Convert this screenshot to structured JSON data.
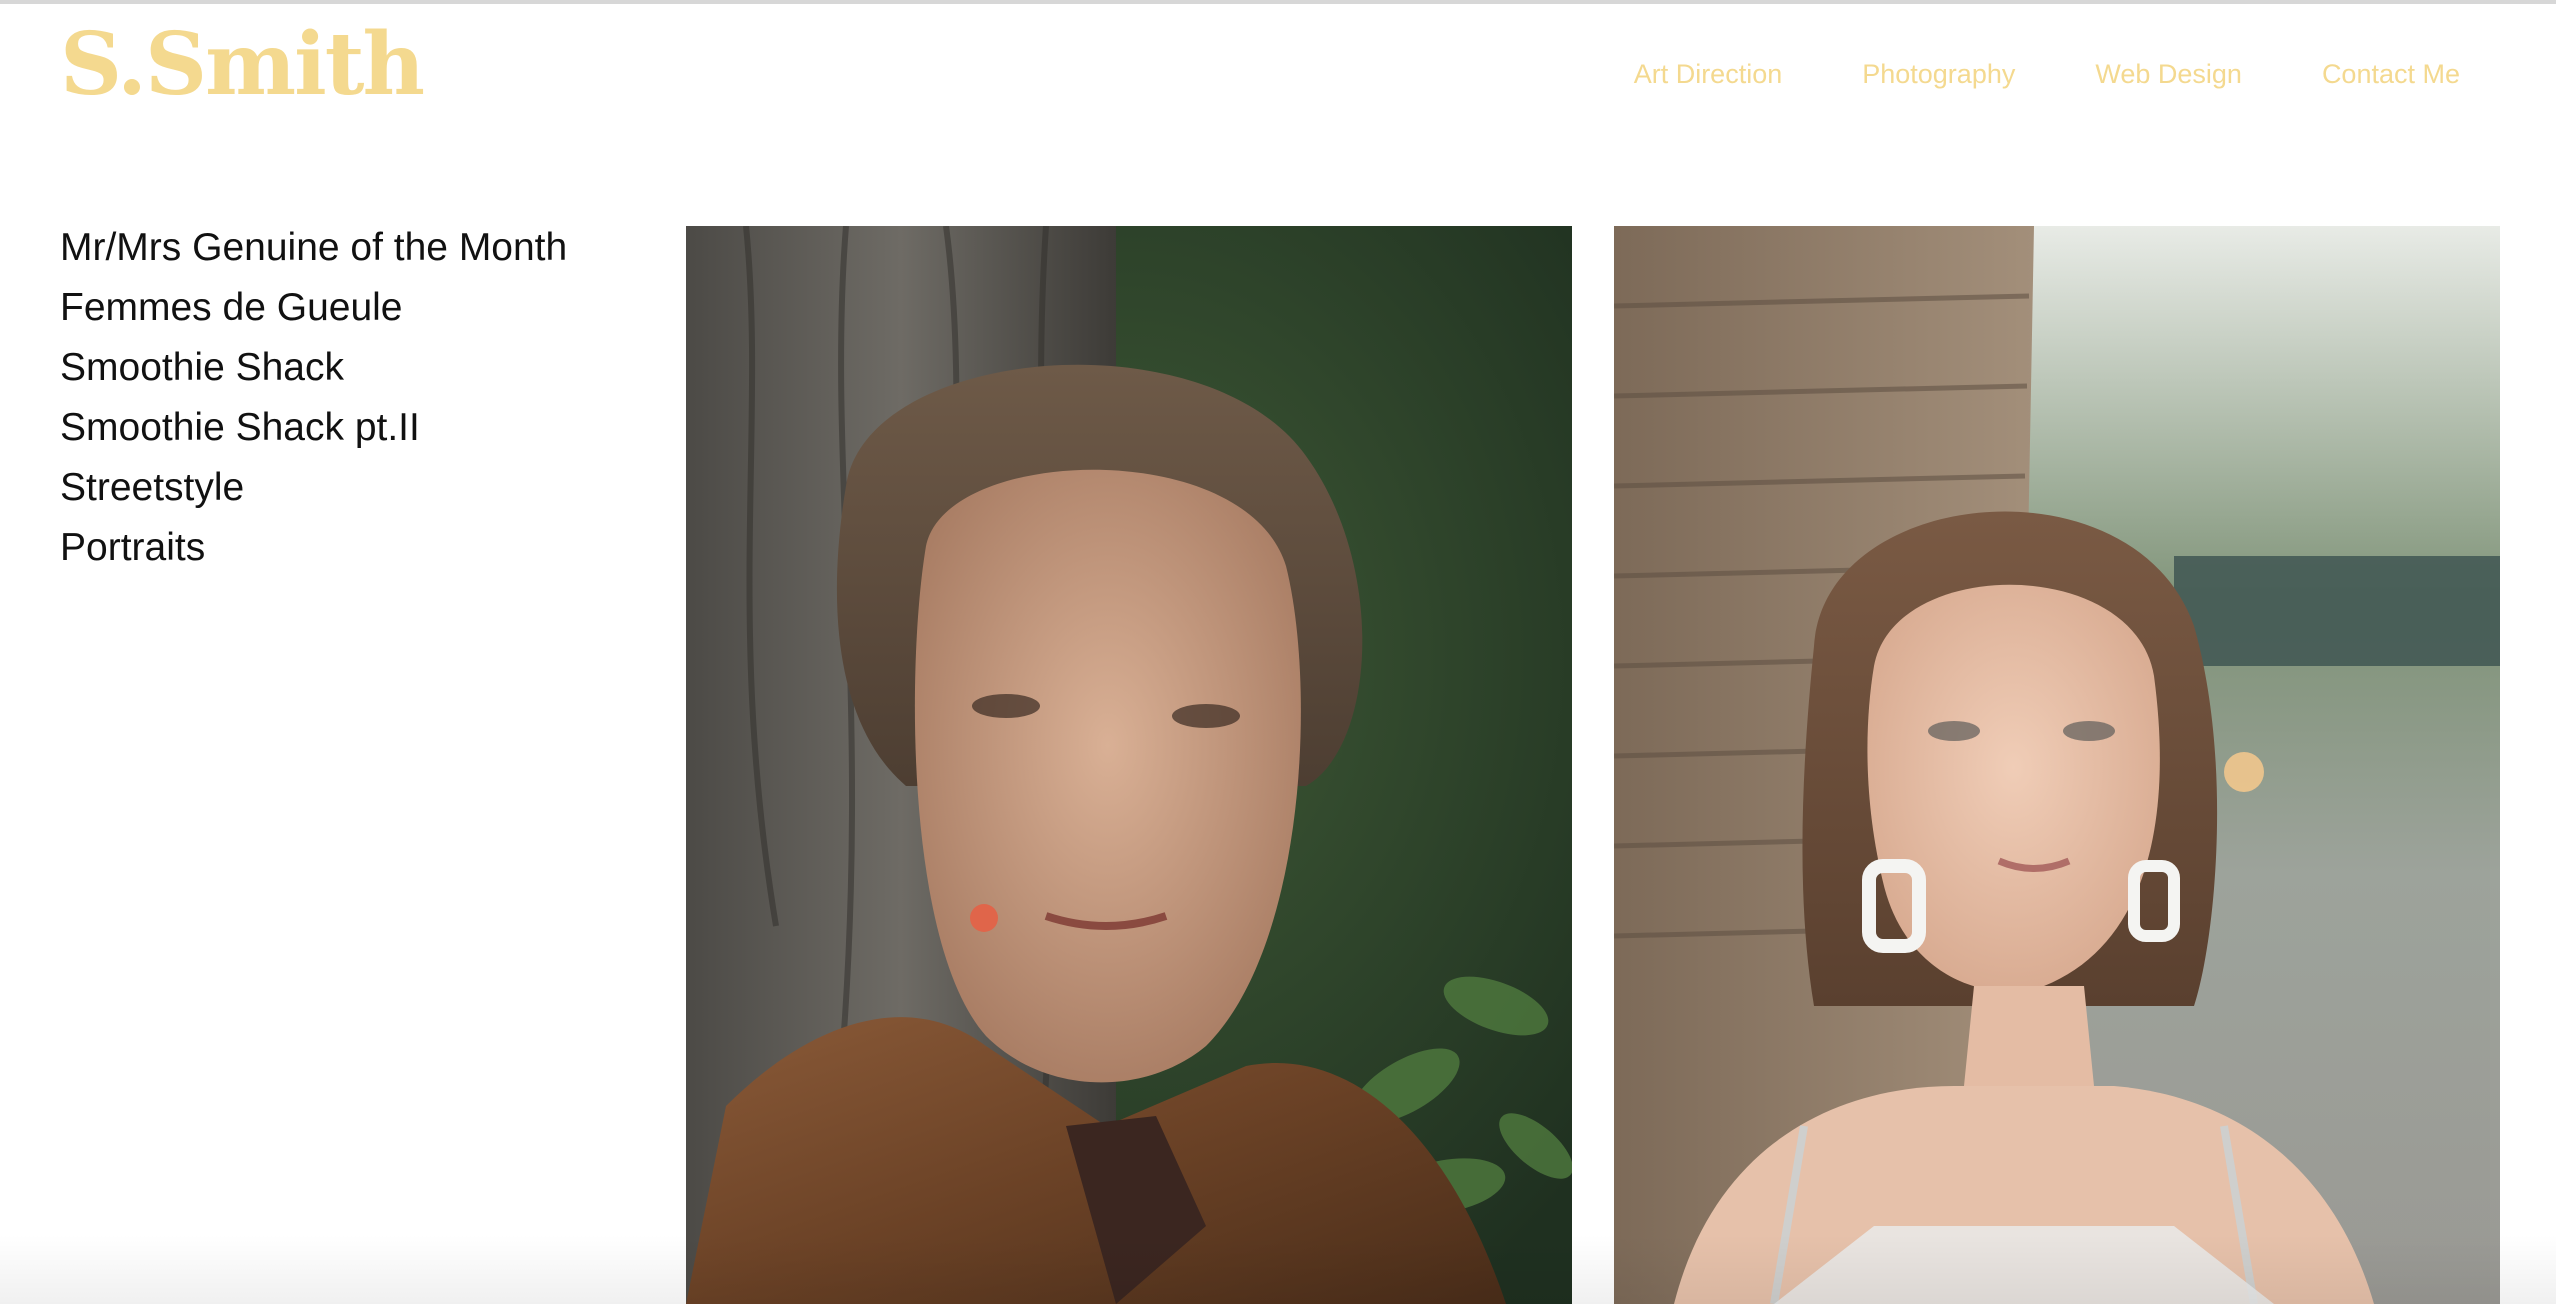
{
  "header": {
    "logo": "S.Smith",
    "nav": [
      {
        "label": "Art Direction"
      },
      {
        "label": "Photography"
      },
      {
        "label": "Web Design"
      },
      {
        "label": "Contact Me"
      }
    ]
  },
  "sidebar": {
    "projects": [
      {
        "label": "Mr/Mrs Genuine of the Month"
      },
      {
        "label": "Femmes de Gueule"
      },
      {
        "label": "Smoothie Shack"
      },
      {
        "label": "Smoothie Shack pt.II"
      },
      {
        "label": "Streetstyle"
      },
      {
        "label": "Portraits"
      }
    ]
  },
  "gallery": {
    "photos": [
      {
        "subject": "portrait-older-woman-fur-coat"
      },
      {
        "subject": "portrait-young-woman-brick-wall"
      }
    ]
  },
  "colors": {
    "accent": "#f4d98f",
    "text": "#111111",
    "background": "#ffffff"
  }
}
